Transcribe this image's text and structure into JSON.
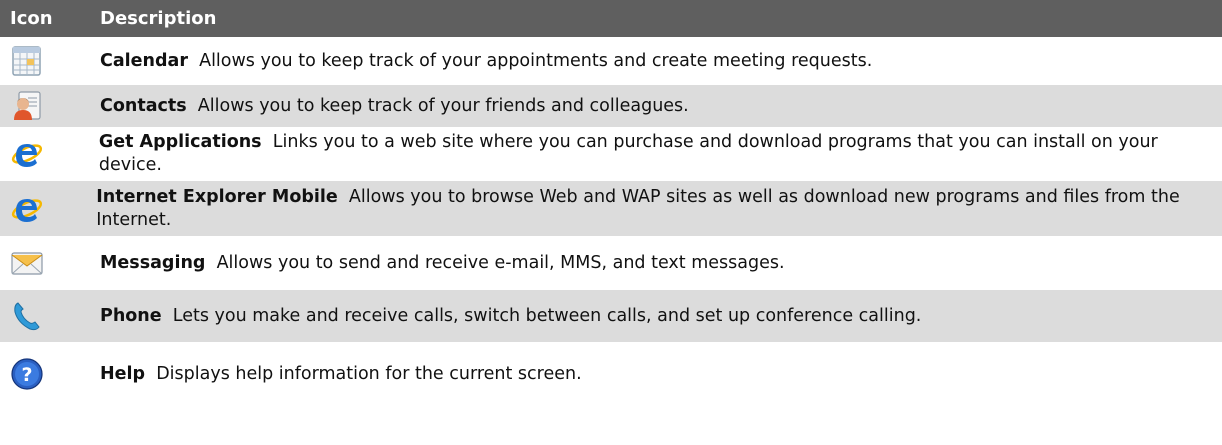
{
  "header": {
    "icon_col": "Icon",
    "desc_col": "Description"
  },
  "rows": [
    {
      "title": "Calendar",
      "text": "Allows you to keep track of your appointments and create meeting requests.",
      "icon": "calendar-icon"
    },
    {
      "title": "Contacts",
      "text": "Allows you to keep track of your friends and colleagues.",
      "icon": "contacts-icon"
    },
    {
      "title": "Get Applications",
      "text": "Links you to a web site where you can purchase and download programs that you can install on your device.",
      "icon": "internet-explorer-icon"
    },
    {
      "title": "Internet Explorer Mobile",
      "text": "Allows you to browse Web and WAP sites as well as download new programs and files from the Internet.",
      "icon": "internet-explorer-icon"
    },
    {
      "title": "Messaging",
      "text": "Allows you to send and receive e-mail, MMS, and text messages.",
      "icon": "envelope-icon"
    },
    {
      "title": "Phone",
      "text": "Lets you make and receive calls, switch between calls, and set up conference calling.",
      "icon": "phone-icon"
    },
    {
      "title": "Help",
      "text": "Displays help information for the current screen.",
      "icon": "help-icon"
    }
  ],
  "colors": {
    "header_bg": "#5f5f5f",
    "shaded_row_bg": "#dcdcdc"
  }
}
